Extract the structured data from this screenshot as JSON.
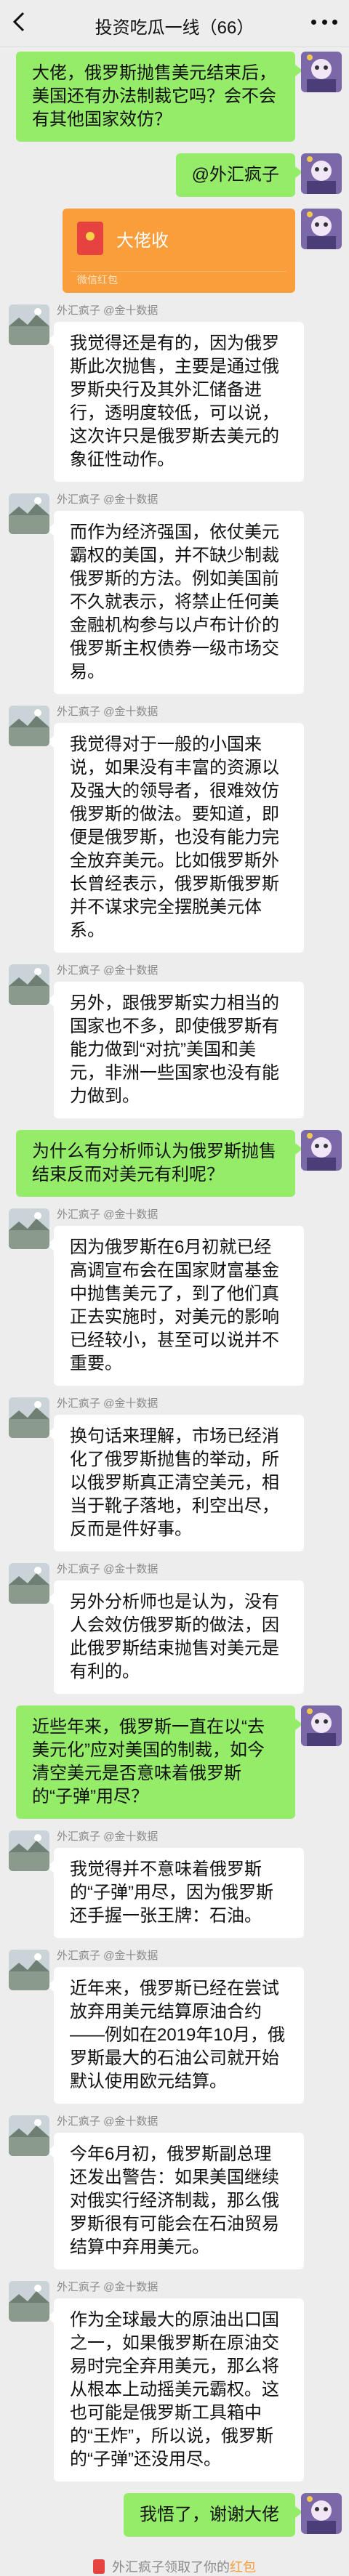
{
  "header": {
    "title": "投资吃瓜一线（66）"
  },
  "sender_name": "外汇疯子",
  "sender_tag": "@金十数据",
  "messages": [
    {
      "side": "right",
      "type": "text",
      "text": "大佬，俄罗斯抛售美元结束后，美国还有办法制裁它吗？会不会有其他国家效仿？"
    },
    {
      "side": "right",
      "type": "text",
      "text": "@外汇疯子"
    },
    {
      "side": "right",
      "type": "redpacket",
      "title": "大佬收",
      "label": "微信红包"
    },
    {
      "side": "left",
      "type": "text",
      "text": "我觉得还是有的，因为俄罗斯此次抛售，主要是通过俄罗斯央行及其外汇储备进行，透明度较低，可以说，这次许只是俄罗斯去美元的象征性动作。"
    },
    {
      "side": "left",
      "type": "text",
      "text": "而作为经济强国，依仗美元霸权的美国，并不缺少制裁俄罗斯的方法。例如美国前不久就表示，将禁止任何美金融机构参与以卢布计价的俄罗斯主权债券一级市场交易。"
    },
    {
      "side": "left",
      "type": "text",
      "text": "我觉得对于一般的小国来说，如果没有丰富的资源以及强大的领导者，很难效仿俄罗斯的做法。要知道，即便是俄罗斯，也没有能力完全放弃美元。比如俄罗斯外长曾经表示，俄罗斯俄罗斯并不谋求完全摆脱美元体系。"
    },
    {
      "side": "left",
      "type": "text",
      "text": "另外，跟俄罗斯实力相当的国家也不多，即使俄罗斯有能力做到“对抗”美国和美元，非洲一些国家也没有能力做到。"
    },
    {
      "side": "right",
      "type": "text",
      "text": "为什么有分析师认为俄罗斯抛售结束反而对美元有利呢？"
    },
    {
      "side": "left",
      "type": "text",
      "text": "因为俄罗斯在6月初就已经高调宣布会在国家财富基金中抛售美元了，到了他们真正去实施时，对美元的影响已经较小，甚至可以说并不重要。"
    },
    {
      "side": "left",
      "type": "text",
      "text": "换句话来理解，市场已经消化了俄罗斯抛售的举动，所以俄罗斯真正清空美元，相当于靴子落地，利空出尽，反而是件好事。"
    },
    {
      "side": "left",
      "type": "text",
      "text": "另外分析师也是认为，没有人会效仿俄罗斯的做法，因此俄罗斯结束抛售对美元是有利的。"
    },
    {
      "side": "right",
      "type": "text",
      "text": "近些年来，俄罗斯一直在以“去美元化”应对美国的制裁，如今清空美元是否意味着俄罗斯的“子弹”用尽？"
    },
    {
      "side": "left",
      "type": "text",
      "text": "我觉得并不意味着俄罗斯的“子弹”用尽，因为俄罗斯还手握一张王牌：石油。"
    },
    {
      "side": "left",
      "type": "text",
      "text": "近年来，俄罗斯已经在尝试放弃用美元结算原油合约——例如在2019年10月，俄罗斯最大的石油公司就开始默认使用欧元结算。"
    },
    {
      "side": "left",
      "type": "text",
      "text": "今年6月初，俄罗斯副总理还发出警告：如果美国继续对俄实行经济制裁，那么俄罗斯很有可能会在石油贸易结算中弃用美元。"
    },
    {
      "side": "left",
      "type": "text",
      "text": "作为全球最大的原油出口国之一，如果俄罗斯在原油交易时完全弃用美元，那么将从根本上动摇美元霸权。这也可能是俄罗斯工具箱中的“王炸”，所以说，俄罗斯的“子弹”还没用尽。"
    },
    {
      "side": "right",
      "type": "text",
      "text": "我悟了，谢谢大佬"
    }
  ],
  "system": {
    "prefix": "外汇疯子领取了你的",
    "highlight": "红包"
  },
  "colors": {
    "green_bubble": "#95ec69",
    "red_packet": "#fa9d3b",
    "background": "#ededed"
  }
}
